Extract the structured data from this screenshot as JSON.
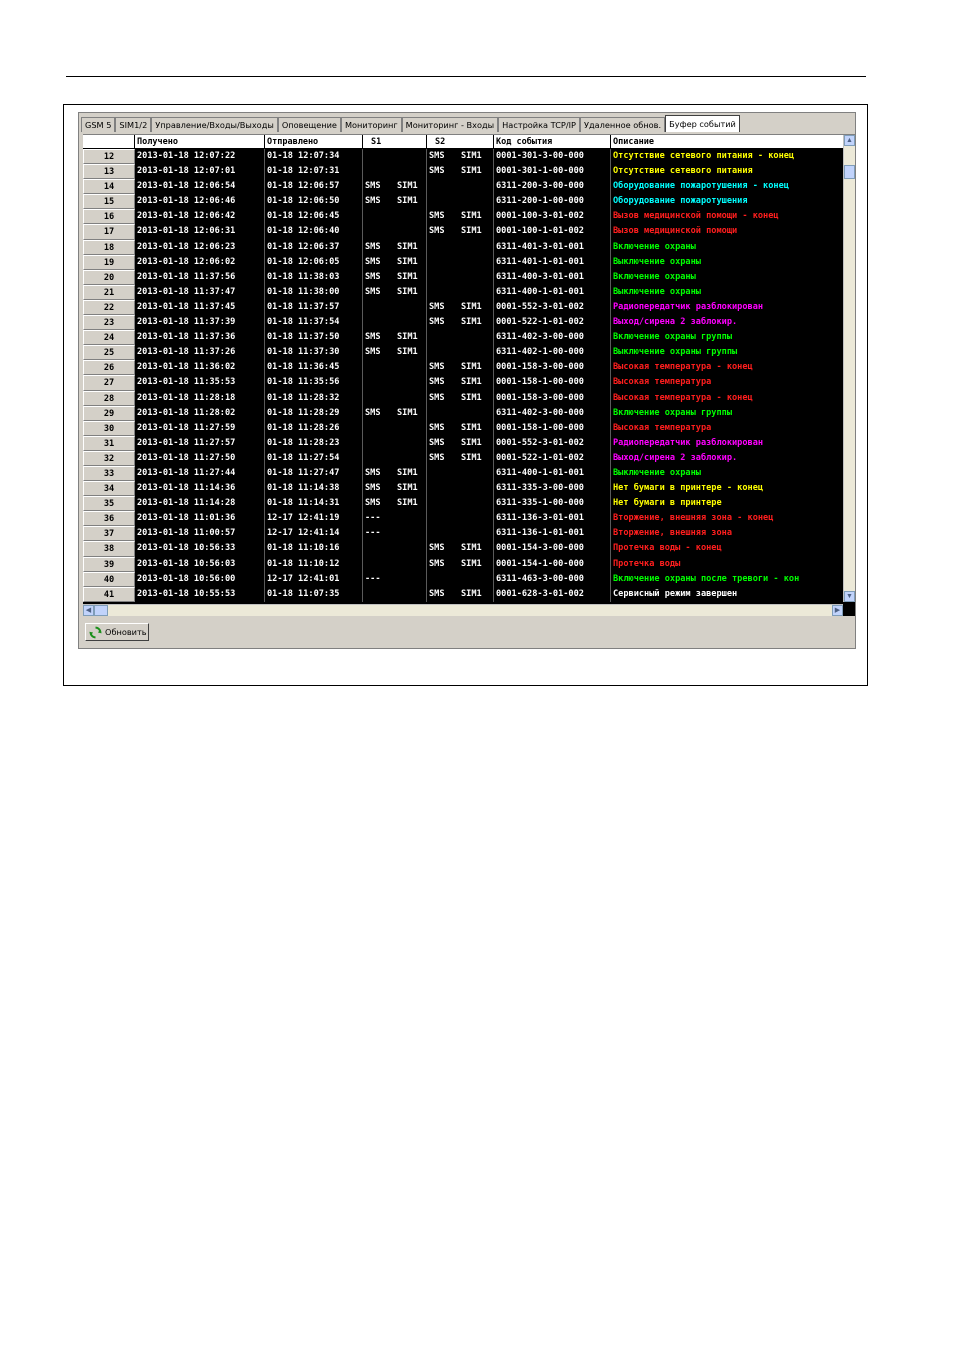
{
  "tabs": [
    "GSM 5",
    "SIM1/2",
    "Управление/Входы/Выходы",
    "Оповещение",
    "Мониторинг",
    "Мониторинг - Входы",
    "Настройка TCP/IP",
    "Удаленное обнов.",
    "Буфер событий"
  ],
  "active_tab": "Буфер событий",
  "columns": [
    "",
    "Получено",
    "Отправлено",
    "S1",
    "",
    "S2",
    "",
    "Код события",
    "Описание"
  ],
  "colors": {
    "yellow": "#ffff00",
    "cyan": "#00ffff",
    "red": "#ff1e1e",
    "green": "#00ff00",
    "magenta": "#ff00ff",
    "white": "#ffffff"
  },
  "rows": [
    {
      "n": "12",
      "received": "2013-01-18 12:07:22",
      "sent": "01-18 12:07:34",
      "s1a": "",
      "s1b": "",
      "s2a": "SMS",
      "s2b": "SIM1",
      "code": "0001-301-3-00-000",
      "desc": "Отсутствие сетевого питания - конец",
      "color": "yellow"
    },
    {
      "n": "13",
      "received": "2013-01-18 12:07:01",
      "sent": "01-18 12:07:31",
      "s1a": "",
      "s1b": "",
      "s2a": "SMS",
      "s2b": "SIM1",
      "code": "0001-301-1-00-000",
      "desc": "Отсутствие сетевого питания",
      "color": "yellow"
    },
    {
      "n": "14",
      "received": "2013-01-18 12:06:54",
      "sent": "01-18 12:06:57",
      "s1a": "SMS",
      "s1b": "SIM1",
      "s2a": "",
      "s2b": "",
      "code": "6311-200-3-00-000",
      "desc": "Оборудование пожаротушения - конец",
      "color": "cyan"
    },
    {
      "n": "15",
      "received": "2013-01-18 12:06:46",
      "sent": "01-18 12:06:50",
      "s1a": "SMS",
      "s1b": "SIM1",
      "s2a": "",
      "s2b": "",
      "code": "6311-200-1-00-000",
      "desc": "Оборудование пожаротушения",
      "color": "cyan"
    },
    {
      "n": "16",
      "received": "2013-01-18 12:06:42",
      "sent": "01-18 12:06:45",
      "s1a": "",
      "s1b": "",
      "s2a": "SMS",
      "s2b": "SIM1",
      "code": "0001-100-3-01-002",
      "desc": "Вызов медицинской помощи - конец",
      "color": "red"
    },
    {
      "n": "17",
      "received": "2013-01-18 12:06:31",
      "sent": "01-18 12:06:40",
      "s1a": "",
      "s1b": "",
      "s2a": "SMS",
      "s2b": "SIM1",
      "code": "0001-100-1-01-002",
      "desc": "Вызов медицинской помощи",
      "color": "red"
    },
    {
      "n": "18",
      "received": "2013-01-18 12:06:23",
      "sent": "01-18 12:06:37",
      "s1a": "SMS",
      "s1b": "SIM1",
      "s2a": "",
      "s2b": "",
      "code": "6311-401-3-01-001",
      "desc": "Включение охраны",
      "color": "green"
    },
    {
      "n": "19",
      "received": "2013-01-18 12:06:02",
      "sent": "01-18 12:06:05",
      "s1a": "SMS",
      "s1b": "SIM1",
      "s2a": "",
      "s2b": "",
      "code": "6311-401-1-01-001",
      "desc": "Выключение охраны",
      "color": "green"
    },
    {
      "n": "20",
      "received": "2013-01-18 11:37:56",
      "sent": "01-18 11:38:03",
      "s1a": "SMS",
      "s1b": "SIM1",
      "s2a": "",
      "s2b": "",
      "code": "6311-400-3-01-001",
      "desc": "Включение охраны",
      "color": "green"
    },
    {
      "n": "21",
      "received": "2013-01-18 11:37:47",
      "sent": "01-18 11:38:00",
      "s1a": "SMS",
      "s1b": "SIM1",
      "s2a": "",
      "s2b": "",
      "code": "6311-400-1-01-001",
      "desc": "Выключение охраны",
      "color": "green"
    },
    {
      "n": "22",
      "received": "2013-01-18 11:37:45",
      "sent": "01-18 11:37:57",
      "s1a": "",
      "s1b": "",
      "s2a": "SMS",
      "s2b": "SIM1",
      "code": "0001-552-3-01-002",
      "desc": "Радиопередатчик разблокирован",
      "color": "magenta"
    },
    {
      "n": "23",
      "received": "2013-01-18 11:37:39",
      "sent": "01-18 11:37:54",
      "s1a": "",
      "s1b": "",
      "s2a": "SMS",
      "s2b": "SIM1",
      "code": "0001-522-1-01-002",
      "desc": "Выход/сирена 2 заблокир.",
      "color": "magenta"
    },
    {
      "n": "24",
      "received": "2013-01-18 11:37:36",
      "sent": "01-18 11:37:50",
      "s1a": "SMS",
      "s1b": "SIM1",
      "s2a": "",
      "s2b": "",
      "code": "6311-402-3-00-000",
      "desc": "Включение охраны группы",
      "color": "green"
    },
    {
      "n": "25",
      "received": "2013-01-18 11:37:26",
      "sent": "01-18 11:37:30",
      "s1a": "SMS",
      "s1b": "SIM1",
      "s2a": "",
      "s2b": "",
      "code": "6311-402-1-00-000",
      "desc": "Выключение охраны группы",
      "color": "green"
    },
    {
      "n": "26",
      "received": "2013-01-18 11:36:02",
      "sent": "01-18 11:36:45",
      "s1a": "",
      "s1b": "",
      "s2a": "SMS",
      "s2b": "SIM1",
      "code": "0001-158-3-00-000",
      "desc": "Высокая температура - конец",
      "color": "red"
    },
    {
      "n": "27",
      "received": "2013-01-18 11:35:53",
      "sent": "01-18 11:35:56",
      "s1a": "",
      "s1b": "",
      "s2a": "SMS",
      "s2b": "SIM1",
      "code": "0001-158-1-00-000",
      "desc": "Высокая температура",
      "color": "red"
    },
    {
      "n": "28",
      "received": "2013-01-18 11:28:18",
      "sent": "01-18 11:28:32",
      "s1a": "",
      "s1b": "",
      "s2a": "SMS",
      "s2b": "SIM1",
      "code": "0001-158-3-00-000",
      "desc": "Высокая температура - конец",
      "color": "red"
    },
    {
      "n": "29",
      "received": "2013-01-18 11:28:02",
      "sent": "01-18 11:28:29",
      "s1a": "SMS",
      "s1b": "SIM1",
      "s2a": "",
      "s2b": "",
      "code": "6311-402-3-00-000",
      "desc": "Включение охраны группы",
      "color": "green"
    },
    {
      "n": "30",
      "received": "2013-01-18 11:27:59",
      "sent": "01-18 11:28:26",
      "s1a": "",
      "s1b": "",
      "s2a": "SMS",
      "s2b": "SIM1",
      "code": "0001-158-1-00-000",
      "desc": "Высокая температура",
      "color": "red"
    },
    {
      "n": "31",
      "received": "2013-01-18 11:27:57",
      "sent": "01-18 11:28:23",
      "s1a": "",
      "s1b": "",
      "s2a": "SMS",
      "s2b": "SIM1",
      "code": "0001-552-3-01-002",
      "desc": "Радиопередатчик разблокирован",
      "color": "magenta"
    },
    {
      "n": "32",
      "received": "2013-01-18 11:27:50",
      "sent": "01-18 11:27:54",
      "s1a": "",
      "s1b": "",
      "s2a": "SMS",
      "s2b": "SIM1",
      "code": "0001-522-1-01-002",
      "desc": "Выход/сирена 2 заблокир.",
      "color": "magenta"
    },
    {
      "n": "33",
      "received": "2013-01-18 11:27:44",
      "sent": "01-18 11:27:47",
      "s1a": "SMS",
      "s1b": "SIM1",
      "s2a": "",
      "s2b": "",
      "code": "6311-400-1-01-001",
      "desc": "Выключение охраны",
      "color": "green"
    },
    {
      "n": "34",
      "received": "2013-01-18 11:14:36",
      "sent": "01-18 11:14:38",
      "s1a": "SMS",
      "s1b": "SIM1",
      "s2a": "",
      "s2b": "",
      "code": "6311-335-3-00-000",
      "desc": "Нет бумаги в принтере - конец",
      "color": "yellow"
    },
    {
      "n": "35",
      "received": "2013-01-18 11:14:28",
      "sent": "01-18 11:14:31",
      "s1a": "SMS",
      "s1b": "SIM1",
      "s2a": "",
      "s2b": "",
      "code": "6311-335-1-00-000",
      "desc": "Нет бумаги в принтере",
      "color": "yellow"
    },
    {
      "n": "36",
      "received": "2013-01-18 11:01:36",
      "sent": "12-17 12:41:19",
      "s1a": "---",
      "s1b": "",
      "s2a": "",
      "s2b": "",
      "code": "6311-136-3-01-001",
      "desc": "Вторжение, внешняя зона - конец",
      "color": "red"
    },
    {
      "n": "37",
      "received": "2013-01-18 11:00:57",
      "sent": "12-17 12:41:14",
      "s1a": "---",
      "s1b": "",
      "s2a": "",
      "s2b": "",
      "code": "6311-136-1-01-001",
      "desc": "Вторжение, внешняя зона",
      "color": "red"
    },
    {
      "n": "38",
      "received": "2013-01-18 10:56:33",
      "sent": "01-18 11:10:16",
      "s1a": "",
      "s1b": "",
      "s2a": "SMS",
      "s2b": "SIM1",
      "code": "0001-154-3-00-000",
      "desc": "Протечка воды - конец",
      "color": "red"
    },
    {
      "n": "39",
      "received": "2013-01-18 10:56:03",
      "sent": "01-18 11:10:12",
      "s1a": "",
      "s1b": "",
      "s2a": "SMS",
      "s2b": "SIM1",
      "code": "0001-154-1-00-000",
      "desc": "Протечка воды",
      "color": "red"
    },
    {
      "n": "40",
      "received": "2013-01-18 10:56:00",
      "sent": "12-17 12:41:01",
      "s1a": "---",
      "s1b": "",
      "s2a": "",
      "s2b": "",
      "code": "6311-463-3-00-000",
      "desc": "Включение охраны после тревоги - кон",
      "color": "green"
    },
    {
      "n": "41",
      "received": "2013-01-18 10:55:53",
      "sent": "01-18 11:07:35",
      "s1a": "",
      "s1b": "",
      "s2a": "SMS",
      "s2b": "SIM1",
      "code": "0001-628-3-01-002",
      "desc": "Сервисный режим завершен",
      "color": "white"
    }
  ],
  "refresh_button": {
    "label": "Обновить",
    "icon": "refresh-icon"
  },
  "scrollbar": {
    "up_arrow": "▲",
    "down_arrow": "▼",
    "left_arrow": "◀",
    "right_arrow": "▶"
  }
}
